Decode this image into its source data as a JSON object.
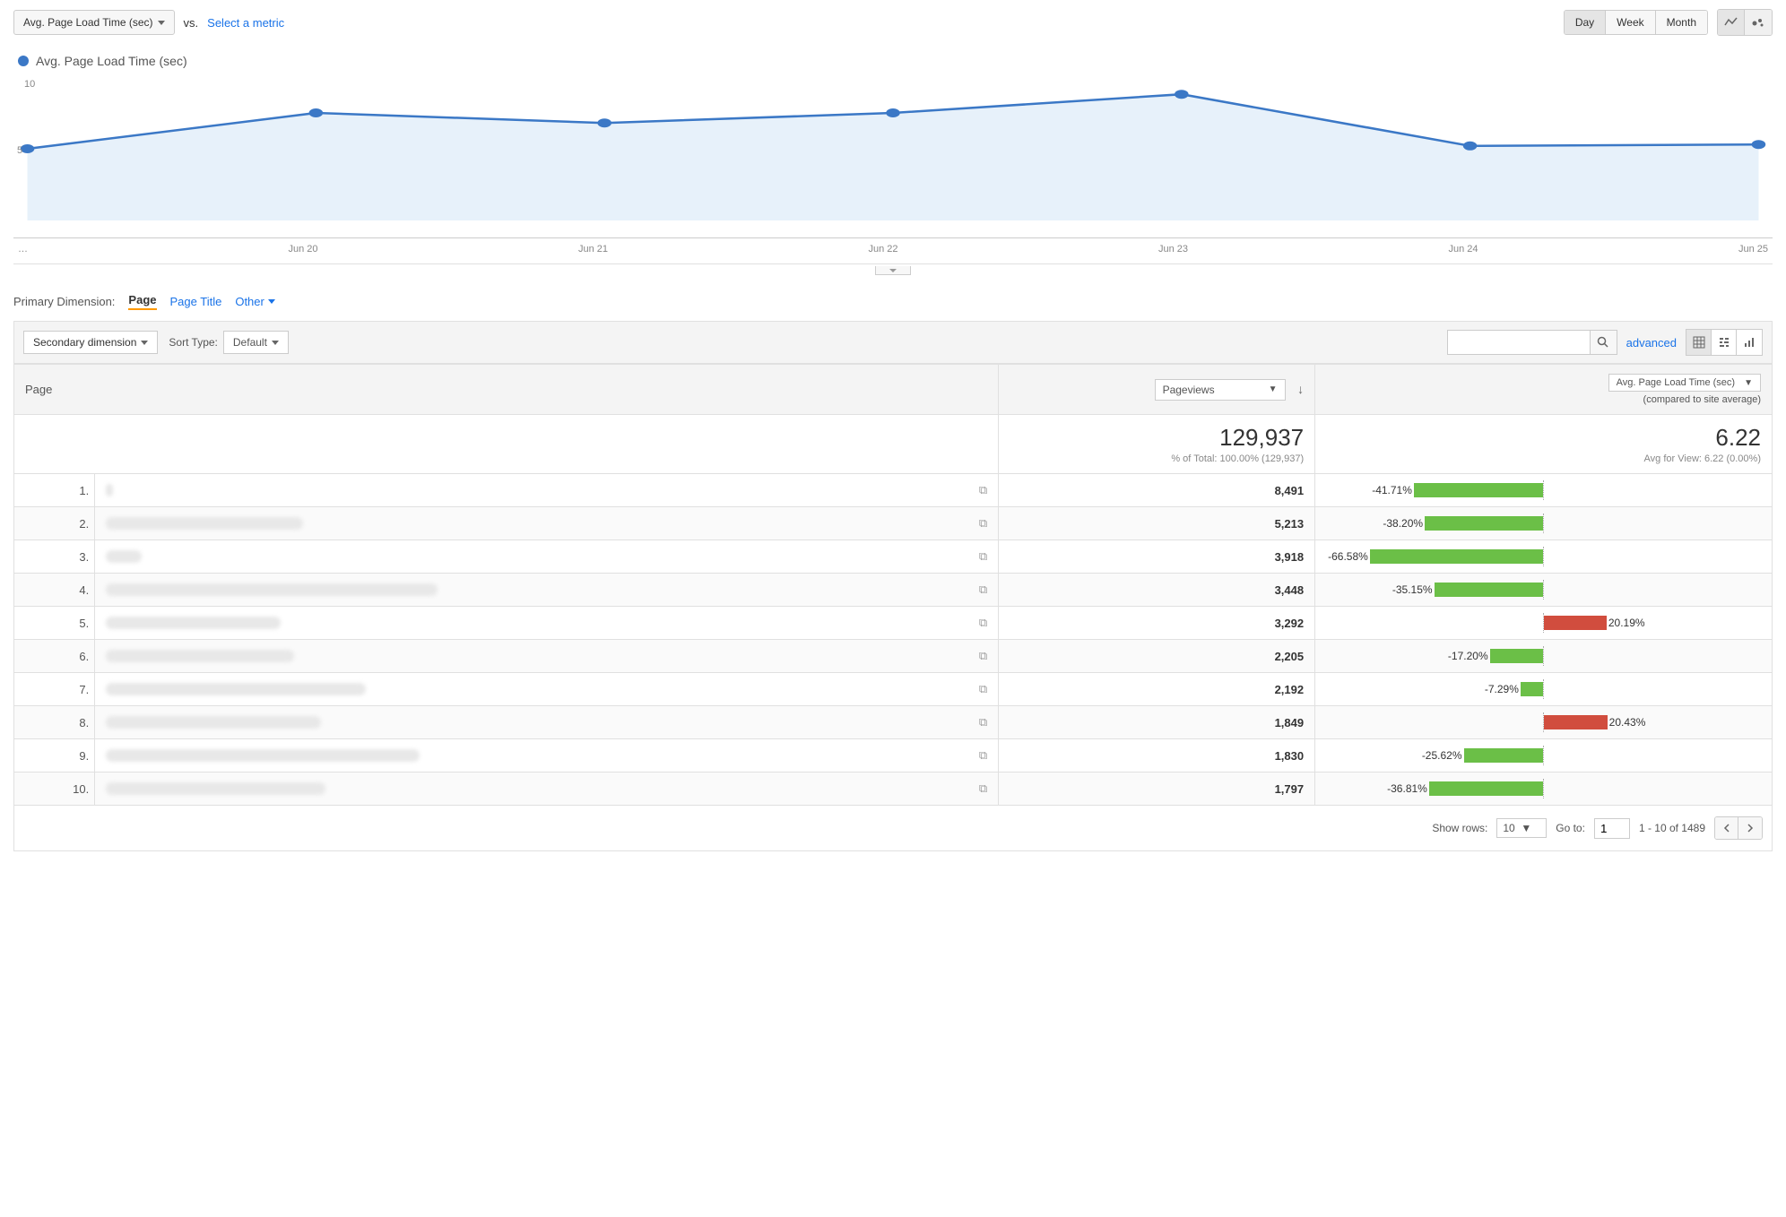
{
  "chart_data": {
    "type": "line",
    "series_name": "Avg. Page Load Time (sec)",
    "categories": [
      "…",
      "Jun 20",
      "Jun 21",
      "Jun 22",
      "Jun 23",
      "Jun 24",
      "Jun 25"
    ],
    "values": [
      5.0,
      7.5,
      6.8,
      7.5,
      8.8,
      5.2,
      5.3
    ],
    "ylim": [
      0,
      10
    ],
    "ytick": 10
  },
  "controls": {
    "metric_selector": "Avg. Page Load Time (sec)",
    "vs": "vs.",
    "select_metric": "Select a metric",
    "time": {
      "day": "Day",
      "week": "Week",
      "month": "Month"
    }
  },
  "legend": {
    "label": "Avg. Page Load Time (sec)"
  },
  "dimension": {
    "label": "Primary Dimension:",
    "page": "Page",
    "page_title": "Page Title",
    "other": "Other"
  },
  "filter": {
    "secondary_dimension": "Secondary dimension",
    "sort_type_label": "Sort Type:",
    "sort_type_value": "Default",
    "advanced": "advanced"
  },
  "table": {
    "col_page": "Page",
    "col_pv_select": "Pageviews",
    "col_cmp_select": "Avg. Page Load Time (sec)",
    "col_cmp_sub": "(compared to site average)",
    "summary_pv": "129,937",
    "summary_pv_sub": "% of Total: 100.00% (129,937)",
    "summary_cmp": "6.22",
    "summary_cmp_sub": "Avg for View: 6.22 (0.00%)",
    "rows": [
      {
        "idx": "1.",
        "blur_w": 8,
        "pv": "8,491",
        "pct": "-41.71%",
        "val": -41.71
      },
      {
        "idx": "2.",
        "blur_w": 220,
        "pv": "5,213",
        "pct": "-38.20%",
        "val": -38.2
      },
      {
        "idx": "3.",
        "blur_w": 40,
        "pv": "3,918",
        "pct": "-66.58%",
        "val": -66.58
      },
      {
        "idx": "4.",
        "blur_w": 370,
        "pv": "3,448",
        "pct": "-35.15%",
        "val": -35.15
      },
      {
        "idx": "5.",
        "blur_w": 195,
        "pv": "3,292",
        "pct": "20.19%",
        "val": 20.19
      },
      {
        "idx": "6.",
        "blur_w": 210,
        "pv": "2,205",
        "pct": "-17.20%",
        "val": -17.2
      },
      {
        "idx": "7.",
        "blur_w": 290,
        "pv": "2,192",
        "pct": "-7.29%",
        "val": -7.29
      },
      {
        "idx": "8.",
        "blur_w": 240,
        "pv": "1,849",
        "pct": "20.43%",
        "val": 20.43
      },
      {
        "idx": "9.",
        "blur_w": 350,
        "pv": "1,830",
        "pct": "-25.62%",
        "val": -25.62
      },
      {
        "idx": "10.",
        "blur_w": 245,
        "pv": "1,797",
        "pct": "-36.81%",
        "val": -36.81
      }
    ]
  },
  "pager": {
    "show_rows": "Show rows:",
    "rows_value": "10",
    "go_to": "Go to:",
    "page_value": "1",
    "range": "1 - 10 of 1489"
  }
}
